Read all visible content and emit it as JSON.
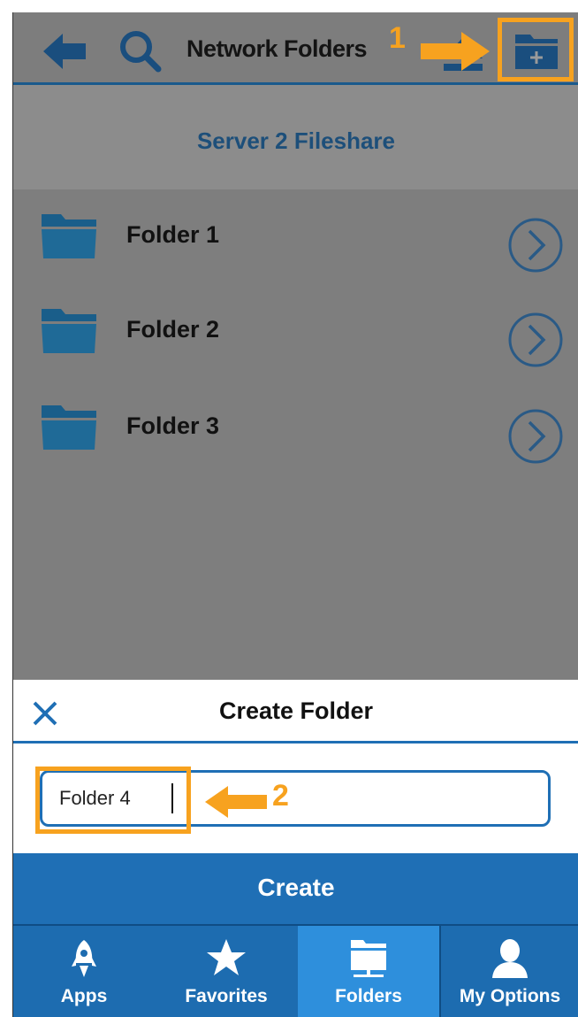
{
  "header": {
    "title": "Network Folders",
    "back_icon": "arrow-left-icon",
    "search_icon": "search-icon",
    "up_icon": "eject-up-icon",
    "new_folder_icon": "folder-plus-icon"
  },
  "location": {
    "label": "Server 2 Fileshare"
  },
  "folders": [
    {
      "name": "Folder 1",
      "icon": "folder-icon"
    },
    {
      "name": "Folder 2",
      "icon": "folder-icon"
    },
    {
      "name": "Folder 3",
      "icon": "folder-icon"
    }
  ],
  "dialog": {
    "title": "Create Folder",
    "close_icon": "close-icon",
    "input_value": "Folder 4",
    "create_label": "Create"
  },
  "tabs": [
    {
      "label": "Apps",
      "icon": "rocket-icon"
    },
    {
      "label": "Favorites",
      "icon": "star-icon"
    },
    {
      "label": "Folders",
      "icon": "folders-icon",
      "active": true
    },
    {
      "label": "My Options",
      "icon": "user-icon"
    }
  ],
  "annotations": {
    "step_1": "1",
    "step_2": "2"
  },
  "colors": {
    "accent": "#1f6fb5",
    "tab_bar": "#1d6cb0",
    "tab_active": "#2e8fdc",
    "highlight": "#f7a21f",
    "overlay": "#7e7e7e"
  }
}
